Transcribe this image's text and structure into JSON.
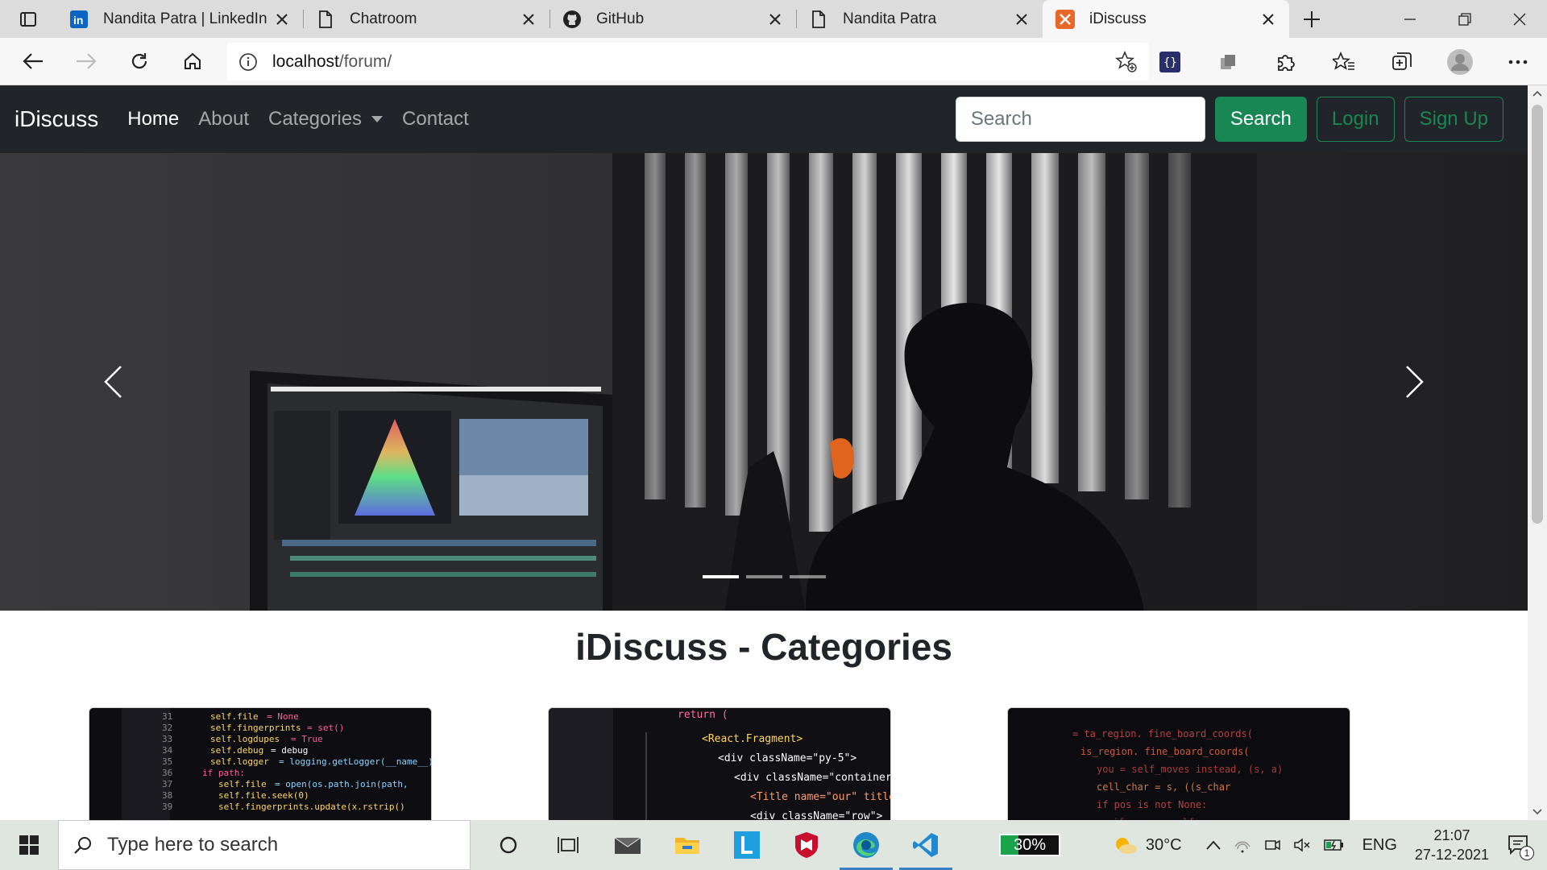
{
  "browser": {
    "tabs": [
      {
        "title": "Nandita Patra | LinkedIn",
        "icon": "linkedin-icon"
      },
      {
        "title": "Chatroom",
        "icon": "page-icon"
      },
      {
        "title": "GitHub",
        "icon": "github-icon"
      },
      {
        "title": "Nandita Patra",
        "icon": "page-icon"
      },
      {
        "title": "iDiscuss",
        "icon": "xampp-icon",
        "active": true
      }
    ],
    "url_host": "localhost",
    "url_path": "/forum/"
  },
  "navbar": {
    "brand": "iDiscuss",
    "links": [
      "Home",
      "About",
      "Categories",
      "Contact"
    ],
    "active_link": "Home",
    "search_placeholder": "Search",
    "search_button": "Search",
    "login_button": "Login",
    "signup_button": "Sign Up"
  },
  "carousel": {
    "slide_count": 3,
    "active_slide": 1
  },
  "categories": {
    "title": "iDiscuss - Categories"
  },
  "taskbar": {
    "search_placeholder": "Type here to search",
    "battery": "30%",
    "weather": "30°C",
    "language": "ENG",
    "time": "21:07",
    "date": "27-12-2021",
    "notification_count": "1"
  },
  "colors": {
    "navbar_bg": "#212529",
    "success": "#198754",
    "accent_tab": "#e8672a"
  }
}
